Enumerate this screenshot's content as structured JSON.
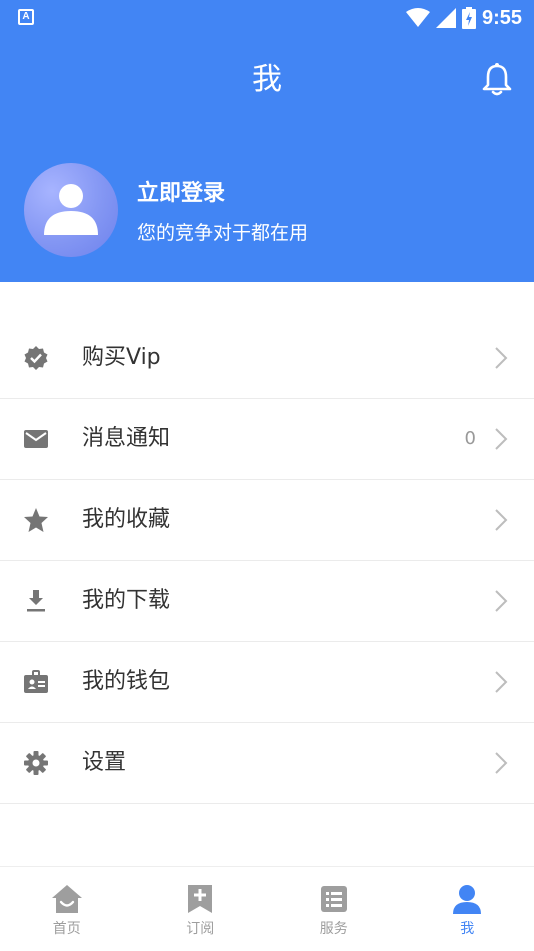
{
  "status_bar": {
    "app_icon_letter": "A",
    "time": "9:55"
  },
  "header": {
    "title": "我",
    "login_title": "立即登录",
    "login_subtitle": "您的竞争对于都在用",
    "background_color": "#4285f4"
  },
  "menu": {
    "items": [
      {
        "label": "购买Vip",
        "icon": "verified-badge-icon",
        "badge": ""
      },
      {
        "label": "消息通知",
        "icon": "mail-icon",
        "badge": "0"
      },
      {
        "label": "我的收藏",
        "icon": "star-icon",
        "badge": ""
      },
      {
        "label": "我的下载",
        "icon": "download-icon",
        "badge": ""
      },
      {
        "label": "我的钱包",
        "icon": "wallet-icon",
        "badge": ""
      },
      {
        "label": "设置",
        "icon": "gear-icon",
        "badge": ""
      }
    ]
  },
  "tabbar": {
    "tabs": [
      {
        "label": "首页",
        "icon": "home-icon",
        "active": false
      },
      {
        "label": "订阅",
        "icon": "subscribe-icon",
        "active": false
      },
      {
        "label": "服务",
        "icon": "service-list-icon",
        "active": false
      },
      {
        "label": "我",
        "icon": "person-icon",
        "active": true
      }
    ],
    "active_color": "#4285f4",
    "inactive_color": "#9e9e9e"
  }
}
